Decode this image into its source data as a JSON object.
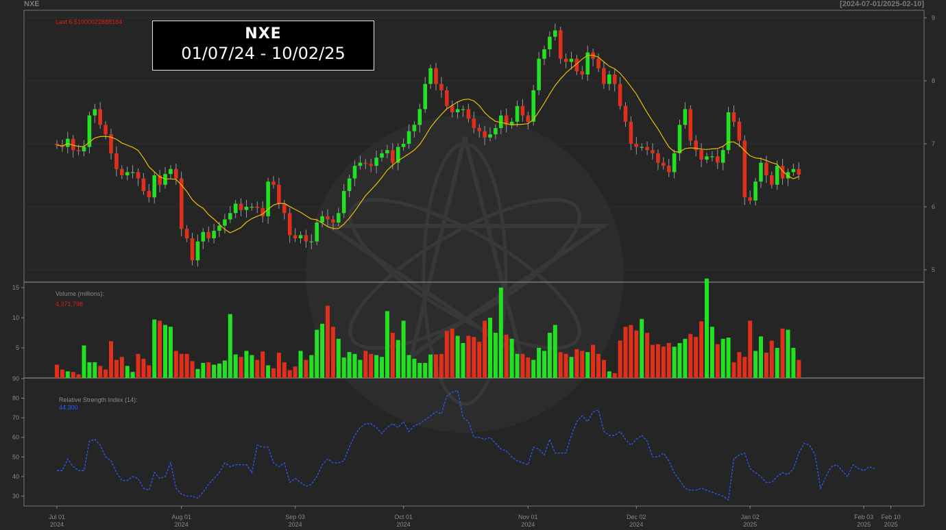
{
  "header": {
    "symbol": "NXE",
    "range": "[2024-07-01/2025-02-10]"
  },
  "title_box": {
    "line1": "NXE",
    "line2": "01/07/24 - 10/02/25"
  },
  "colors": {
    "up": "#22e022",
    "down": "#e0301c",
    "ma": "#e8c000",
    "rsi": "#2a5cff",
    "background": "#252525",
    "text": "#8a8a8a",
    "last_label": "#e02010"
  },
  "chart_data": [
    {
      "type": "candlestick",
      "name": "price",
      "annotation": "Last 6.51000022888184",
      "ylim": [
        4.8,
        9.15
      ],
      "yticks": [
        5,
        6,
        7,
        8,
        9
      ],
      "overlay_color": "#e8c000",
      "close": [
        6.98,
        6.95,
        7.08,
        6.9,
        6.88,
        6.95,
        7.45,
        7.55,
        7.3,
        7.15,
        6.85,
        6.6,
        6.5,
        6.55,
        6.55,
        6.45,
        6.25,
        6.15,
        6.5,
        6.35,
        6.52,
        6.6,
        6.45,
        5.65,
        5.5,
        5.15,
        5.45,
        5.6,
        5.5,
        5.62,
        5.7,
        5.8,
        5.9,
        6.05,
        5.95,
        6.0,
        6.0,
        5.98,
        5.85,
        6.4,
        6.35,
        6.05,
        5.9,
        5.55,
        5.5,
        5.55,
        5.45,
        5.45,
        5.75,
        5.85,
        5.8,
        5.75,
        5.9,
        6.25,
        6.45,
        6.65,
        6.7,
        6.68,
        6.65,
        6.78,
        6.85,
        6.9,
        6.7,
        6.95,
        7.0,
        7.2,
        7.3,
        7.55,
        7.95,
        8.2,
        7.95,
        7.85,
        7.6,
        7.5,
        7.55,
        7.55,
        7.4,
        7.25,
        7.2,
        7.1,
        7.15,
        7.25,
        7.45,
        7.3,
        7.35,
        7.6,
        7.45,
        7.35,
        7.85,
        8.35,
        8.5,
        8.7,
        8.8,
        8.35,
        8.3,
        8.35,
        8.15,
        8.1,
        8.45,
        8.35,
        8.2,
        7.95,
        8.1,
        7.95,
        7.6,
        7.35,
        7.0,
        6.95,
        6.95,
        6.9,
        6.85,
        6.7,
        6.65,
        6.55,
        6.85,
        7.3,
        7.55,
        7.05,
        6.9,
        6.75,
        6.8,
        6.8,
        6.7,
        6.9,
        7.5,
        7.35,
        7.05,
        6.15,
        6.1,
        6.4,
        6.7,
        6.5,
        6.35,
        6.65,
        6.45,
        6.55,
        6.6,
        6.51
      ],
      "volume_millions": [
        2.2,
        1.4,
        1.1,
        1.0,
        0.6,
        5.4,
        2.6,
        2.6,
        2.0,
        1.4,
        6.1,
        3.0,
        3.5,
        2.0,
        1.0,
        4.0,
        3.2,
        2.1,
        9.7,
        9.5,
        8.8,
        8.5,
        4.5,
        4.0,
        4.0,
        2.8,
        1.5,
        2.5,
        2.6,
        2.2,
        2.4,
        2.9,
        10.6,
        3.9,
        3.5,
        4.5,
        3.8,
        3.0,
        4.4,
        2.1,
        1.6,
        4.2,
        2.6,
        1.3,
        1.9,
        4.5,
        3.0,
        3.8,
        8.0,
        9.0,
        12.0,
        8.5,
        6.5,
        3.4,
        4.3,
        4.0,
        3.0,
        4.5,
        4.0,
        3.8,
        3.5,
        11.1,
        7.5,
        6.3,
        9.5,
        3.8,
        3.2,
        2.5,
        2.5,
        3.9,
        3.9,
        4.0,
        7.8,
        8.2,
        7.0,
        5.8,
        7.0,
        6.8,
        6.0,
        9.5,
        10.0,
        7.5,
        15.0,
        7.2,
        6.5,
        4.0,
        4.0,
        3.4,
        3.0,
        5.0,
        4.5,
        7.5,
        8.8,
        4.3,
        4.0,
        3.5,
        4.8,
        4.5,
        4.3,
        5.5,
        4.0,
        3.0,
        1.1,
        0.8,
        6.2,
        8.5,
        8.8,
        7.9,
        9.8,
        7.5,
        5.5,
        5.6,
        5.2,
        5.8,
        5.2,
        5.8,
        6.5,
        7.3,
        6.8,
        9.4,
        16.5,
        8.5,
        5.6,
        6.5,
        6.7,
        2.6,
        4.3,
        3.5,
        9.5,
        4.5,
        6.9,
        4.2,
        6.2,
        5.0,
        8.2,
        8.0,
        5.0,
        3.0
      ],
      "volume_label": "Volume (millions):",
      "volume_value": "4,371,798",
      "volume_yticks": [
        5,
        10,
        15
      ]
    },
    {
      "type": "line",
      "name": "rsi",
      "label": "Relative Strength Index (14):",
      "value": "44.300",
      "ylim": [
        25,
        90
      ],
      "yticks": [
        30,
        40,
        50,
        60,
        70,
        80,
        90
      ],
      "values": [
        43,
        43,
        49,
        45,
        43,
        43,
        58,
        59,
        56,
        50,
        48,
        42,
        38,
        38,
        40,
        39,
        34,
        33,
        42,
        39,
        40,
        47,
        34,
        31,
        30,
        30,
        29,
        32,
        36,
        39,
        42,
        47,
        45,
        46,
        46,
        46,
        42,
        56,
        55,
        55,
        47,
        45,
        47,
        37,
        39,
        37,
        35,
        36,
        40,
        46,
        49,
        47,
        47,
        48,
        55,
        61,
        65,
        67,
        67,
        65,
        62,
        65,
        67,
        65,
        68,
        63,
        66,
        67,
        69,
        71,
        73,
        72,
        81,
        83,
        84,
        70,
        68,
        60,
        60,
        59,
        60,
        57,
        54,
        53,
        50,
        48,
        47,
        46,
        55,
        54,
        51,
        59,
        52,
        52,
        52,
        61,
        68,
        71,
        68,
        73,
        74,
        63,
        61,
        61,
        63,
        59,
        56,
        59,
        61,
        58,
        50,
        50,
        52,
        48,
        42,
        38,
        34,
        33,
        33,
        34,
        33,
        32,
        31,
        30,
        28,
        49,
        51,
        52,
        44,
        42,
        40,
        37,
        37,
        40,
        42,
        41,
        44,
        52,
        57,
        56,
        51,
        34,
        40,
        45,
        46,
        43,
        40,
        46,
        44,
        43,
        45,
        44
      ],
      "y_axis": "right"
    }
  ],
  "x_axis": {
    "labels": [
      {
        "top": "Jul 01",
        "bottom": "2024",
        "idx": 0
      },
      {
        "top": "Aug 01",
        "bottom": "2024",
        "idx": 23
      },
      {
        "top": "Sep 03",
        "bottom": "2024",
        "idx": 44
      },
      {
        "top": "Oct 01",
        "bottom": "2024",
        "idx": 64
      },
      {
        "top": "Nov 01",
        "bottom": "2024",
        "idx": 87
      },
      {
        "top": "Dec 02",
        "bottom": "2024",
        "idx": 107
      },
      {
        "top": "Jan 02",
        "bottom": "2025",
        "idx": 128
      },
      {
        "top": "Feb 03",
        "bottom": "2025",
        "idx": 149
      },
      {
        "top": "Feb 10",
        "bottom": "2025",
        "idx": 154
      }
    ]
  }
}
